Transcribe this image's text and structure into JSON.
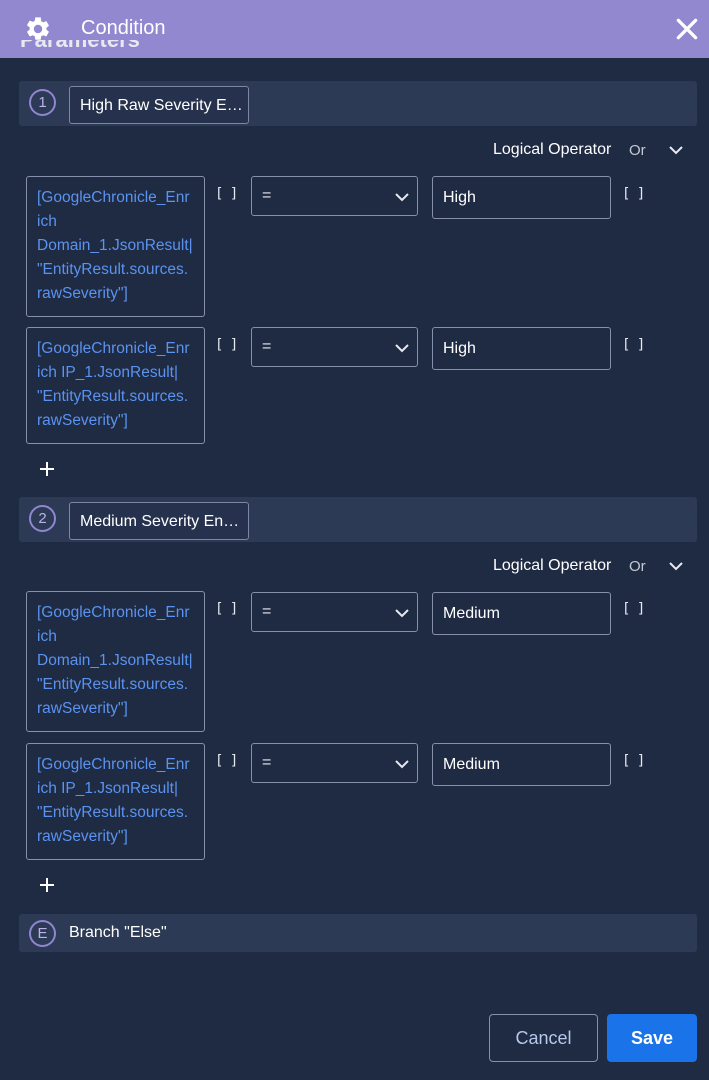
{
  "header": {
    "title": "Condition",
    "settings_icon": "gear-icon",
    "close_icon": "close-icon",
    "background": "#9188d0"
  },
  "section_heading": "Parameters",
  "branches": [
    {
      "number": "1",
      "name": "High Raw Severity E…",
      "logical_operator_label": "Logical Operator",
      "logical_operator_value": "Or",
      "conditions": [
        {
          "param_lines": [
            "[GoogleChronicle_Enr",
            "ich",
            "Domain_1.JsonResult|",
            "\"EntityResult.sources.",
            "rawSeverity\"]"
          ],
          "param_bracket": "[ ]",
          "operator": "=",
          "value": "High",
          "value_bracket": "[ ]"
        },
        {
          "param_lines": [
            "[GoogleChronicle_Enr",
            "ich IP_1.JsonResult|",
            "\"EntityResult.sources.",
            "rawSeverity\"]"
          ],
          "param_bracket": "[ ]",
          "operator": "=",
          "value": "High",
          "value_bracket": "[ ]"
        }
      ]
    },
    {
      "number": "2",
      "name": "Medium Severity En…",
      "logical_operator_label": "Logical Operator",
      "logical_operator_value": "Or",
      "conditions": [
        {
          "param_lines": [
            "[GoogleChronicle_Enr",
            "ich",
            "Domain_1.JsonResult|",
            "\"EntityResult.sources.",
            "rawSeverity\"]"
          ],
          "param_bracket": "[ ]",
          "operator": "=",
          "value": "Medium",
          "value_bracket": "[ ]"
        },
        {
          "param_lines": [
            "[GoogleChronicle_Enr",
            "ich IP_1.JsonResult|",
            "\"EntityResult.sources.",
            "rawSeverity\"]"
          ],
          "param_bracket": "[ ]",
          "operator": "=",
          "value": "Medium",
          "value_bracket": "[ ]"
        }
      ]
    }
  ],
  "else_branch": {
    "marker": "E",
    "label": "Branch \"Else\""
  },
  "footer": {
    "cancel_label": "Cancel",
    "save_label": "Save",
    "save_color": "#1a73e8"
  },
  "colors": {
    "background": "#1f2a43",
    "branch_row": "#2d3a55",
    "param_text": "#5a93f0",
    "circle_accent": "#8f86cf"
  }
}
